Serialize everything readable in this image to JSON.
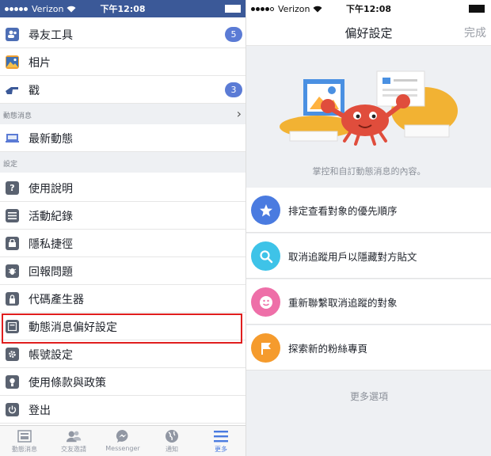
{
  "left": {
    "status": {
      "carrier": "Verizon",
      "time": "下午12:08"
    },
    "rows": [
      {
        "label": "尋友工具",
        "icon": "friends-icon",
        "badge": "5"
      },
      {
        "label": "相片",
        "icon": "photos-icon"
      },
      {
        "label": "戳",
        "icon": "poke-icon",
        "badge": "3"
      }
    ],
    "section_feed": "動態消息",
    "feed_row": {
      "label": "最新動態",
      "icon": "most-recent-icon"
    },
    "section_settings": "設定",
    "settings_rows": [
      {
        "label": "使用說明",
        "icon": "help-icon"
      },
      {
        "label": "活動紀錄",
        "icon": "activity-log-icon"
      },
      {
        "label": "隱私捷徑",
        "icon": "privacy-shortcuts-icon"
      },
      {
        "label": "回報問題",
        "icon": "report-problem-icon"
      },
      {
        "label": "代碼產生器",
        "icon": "code-generator-icon"
      },
      {
        "label": "動態消息偏好設定",
        "icon": "news-feed-preferences-icon"
      },
      {
        "label": "帳號設定",
        "icon": "account-settings-icon"
      },
      {
        "label": "使用條款與政策",
        "icon": "terms-policies-icon"
      },
      {
        "label": "登出",
        "icon": "log-out-icon"
      }
    ],
    "tabs": [
      {
        "label": "動態消息",
        "icon": "news-feed-tab-icon"
      },
      {
        "label": "交友邀請",
        "icon": "friend-requests-tab-icon"
      },
      {
        "label": "Messenger",
        "icon": "messenger-tab-icon"
      },
      {
        "label": "通知",
        "icon": "notifications-tab-icon"
      },
      {
        "label": "更多",
        "icon": "more-tab-icon"
      }
    ]
  },
  "right": {
    "status": {
      "carrier": "Verizon",
      "time": "下午12:08"
    },
    "title": "偏好設定",
    "done": "完成",
    "caption": "掌控和自訂動態消息的內容。",
    "options": [
      {
        "label": "排定查看對象的優先順序",
        "icon": "star-icon",
        "color": "#4a7be0"
      },
      {
        "label": "取消追蹤用戶以隱藏對方貼文",
        "icon": "search-icon",
        "color": "#3ec3e8"
      },
      {
        "label": "重新聯繫取消追蹤的對象",
        "icon": "smiley-icon",
        "color": "#ee6fa8"
      },
      {
        "label": "探索新的粉絲專頁",
        "icon": "flag-icon",
        "color": "#f59b2d"
      }
    ],
    "more_options": "更多選項"
  },
  "colors": {
    "brand": "#3b5998",
    "badge": "#5b7bd5",
    "highlight": "#e01e1e"
  }
}
